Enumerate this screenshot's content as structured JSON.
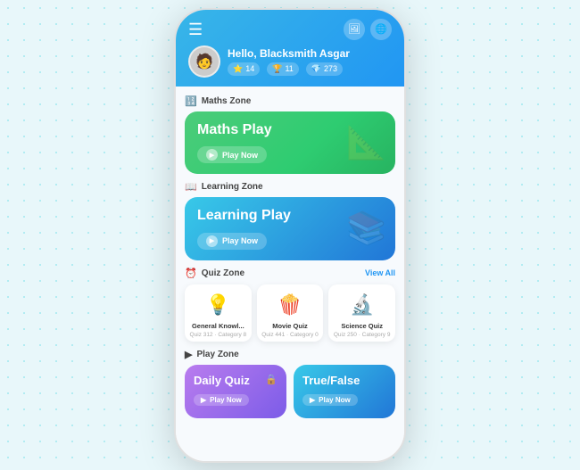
{
  "header": {
    "greeting": "Hello, Blacksmith Asgar",
    "stats": [
      {
        "icon": "⭐",
        "value": "14"
      },
      {
        "icon": "🏆",
        "value": "11"
      },
      {
        "icon": "💎",
        "value": "273"
      }
    ],
    "menu_icon": "☰",
    "icon1": "🖼",
    "icon2": "🌐"
  },
  "maths_zone": {
    "label": "Maths Zone",
    "icon": "123",
    "card_title": "Maths Play",
    "play_label": "Play Now"
  },
  "learning_zone": {
    "label": "Learning Zone",
    "icon": "📖",
    "card_title": "Learning Play",
    "play_label": "Play Now"
  },
  "quiz_zone": {
    "label": "Quiz Zone",
    "icon": "⏰",
    "view_all": "View All",
    "items": [
      {
        "name": "General Knowl...",
        "meta": "Quiz 312 · Category 8",
        "emoji": "💡"
      },
      {
        "name": "Movie Quiz",
        "meta": "Quiz 441 · Category 0",
        "emoji": "🍿"
      },
      {
        "name": "Science Quiz",
        "meta": "Quiz 250 · Category 9",
        "emoji": "🔬"
      }
    ]
  },
  "play_zone": {
    "label": "Play Zone",
    "icon": "▶",
    "daily_quiz": {
      "title": "Daily Quiz",
      "play_label": "Play Now"
    },
    "true_false": {
      "title": "True/False",
      "play_label": "Play Now"
    }
  }
}
